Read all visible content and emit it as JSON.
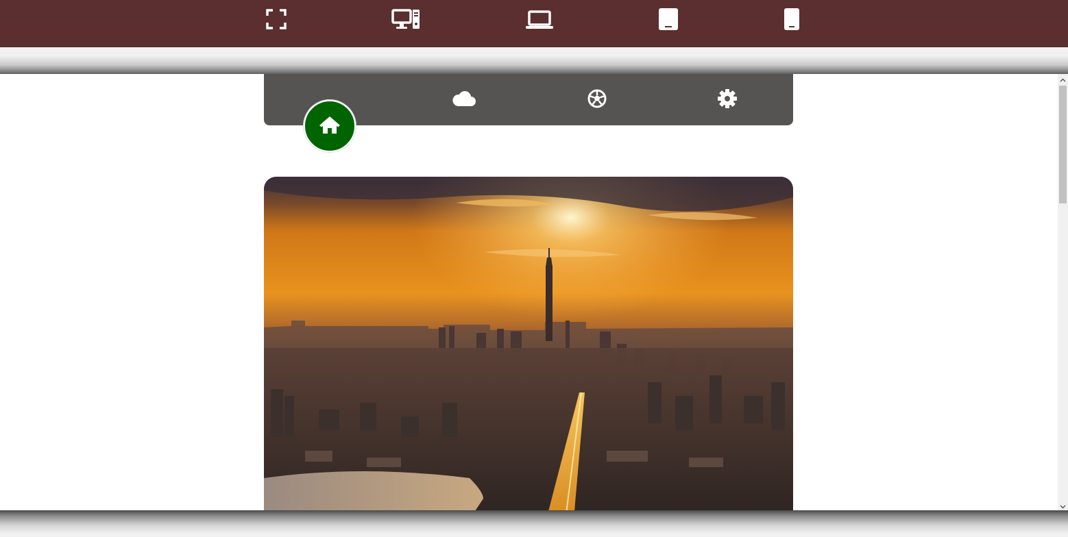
{
  "toolbar": {
    "devices": [
      {
        "name": "fullscreen",
        "icon": "fullscreen-icon"
      },
      {
        "name": "desktop",
        "icon": "desktop-icon"
      },
      {
        "name": "laptop",
        "icon": "laptop-icon"
      },
      {
        "name": "tablet",
        "icon": "tablet-icon"
      },
      {
        "name": "mobile",
        "icon": "mobile-icon"
      }
    ],
    "background_color": "#5b2e2f"
  },
  "nav": {
    "items": [
      {
        "name": "home",
        "icon": "home-icon",
        "active": true
      },
      {
        "name": "cloud",
        "icon": "cloud-icon",
        "active": false
      },
      {
        "name": "sports",
        "icon": "soccer-ball-icon",
        "active": false
      },
      {
        "name": "settings",
        "icon": "gear-icon",
        "active": false
      }
    ],
    "bar_color": "#555453",
    "active_color": "#006400"
  },
  "hero": {
    "icon": "city-sunset-image"
  }
}
